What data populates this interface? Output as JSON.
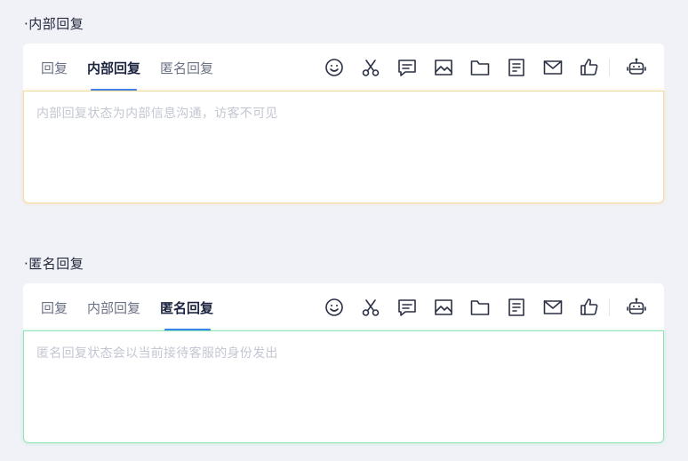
{
  "sections": [
    {
      "title": "·内部回复",
      "tabs": [
        "回复",
        "内部回复",
        "匿名回复"
      ],
      "active_tab": "内部回复",
      "placeholder": "内部回复状态为内部信息沟通，访客不可见",
      "border_color": "#f7d99a"
    },
    {
      "title": "·匿名回复",
      "tabs": [
        "回复",
        "内部回复",
        "匿名回复"
      ],
      "active_tab": "匿名回复",
      "placeholder": "匿名回复状态会以当前接待客服的身份发出",
      "border_color": "#8ee3b3"
    }
  ],
  "toolbar_icons": [
    "emoji-icon",
    "scissors-icon",
    "comment-icon",
    "image-icon",
    "folder-icon",
    "document-icon",
    "mail-icon",
    "thumbs-up-icon",
    "robot-icon"
  ],
  "colors": {
    "accent": "#2f7cf6",
    "background": "#f0f2f7"
  }
}
